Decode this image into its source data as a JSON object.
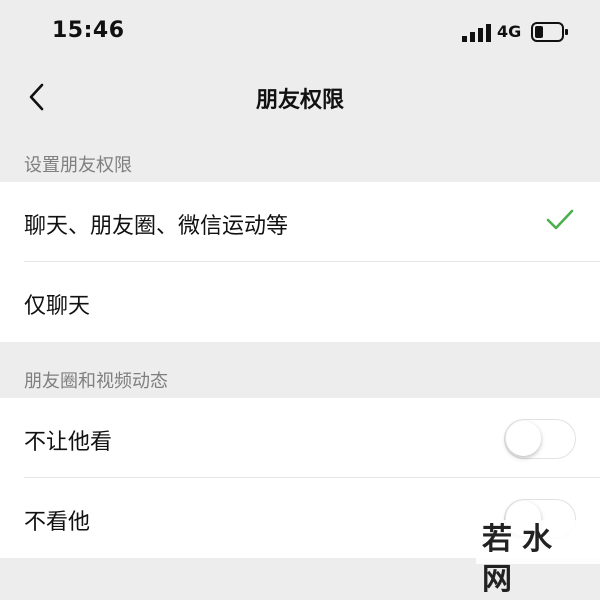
{
  "status_bar": {
    "time": "15:46",
    "network": "4G",
    "signal_icon": "signal-bars-icon",
    "battery_icon": "battery-low-icon"
  },
  "nav": {
    "title": "朋友权限",
    "back_icon": "chevron-left-icon"
  },
  "sections": [
    {
      "header": "设置朋友权限",
      "items": [
        {
          "label": "聊天、朋友圈、微信运动等",
          "selected": true
        },
        {
          "label": "仅聊天",
          "selected": false
        }
      ]
    },
    {
      "header": "朋友圈和视频动态",
      "items": [
        {
          "label": "不让他看",
          "toggle_on": false
        },
        {
          "label": "不看他",
          "toggle_on": false
        }
      ]
    }
  ],
  "colors": {
    "background": "#ededed",
    "accent_green": "#07c160",
    "row_background": "#ffffff"
  },
  "watermark": "若水网"
}
